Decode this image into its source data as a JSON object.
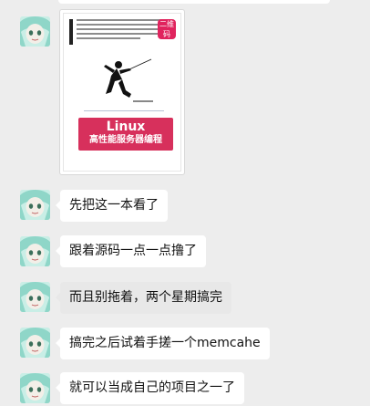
{
  "book_image": {
    "title": "Linux",
    "subtitle": "高性能服务器编程",
    "badge_text": "二维码",
    "badge_label": "",
    "publisher": ""
  },
  "messages": [
    {
      "text": "先把这一本看了",
      "highlight": false
    },
    {
      "text": "跟着源码一点一点撸了",
      "highlight": false
    },
    {
      "text": "而且别拖着，两个星期搞完",
      "highlight": true
    },
    {
      "text": "搞完之后试着手搓一个memcahe",
      "highlight": false
    },
    {
      "text": "就可以当成自己的项目之一了",
      "highlight": false
    }
  ],
  "colors": {
    "chat_bg": "#ededed",
    "bubble_bg": "#ffffff",
    "bubble_highlight_bg": "#e8e8e8",
    "book_red": "#d7305c",
    "avatar_bg": "#c9eee6"
  },
  "icons": {
    "avatar": "anime-avatar-icon"
  }
}
